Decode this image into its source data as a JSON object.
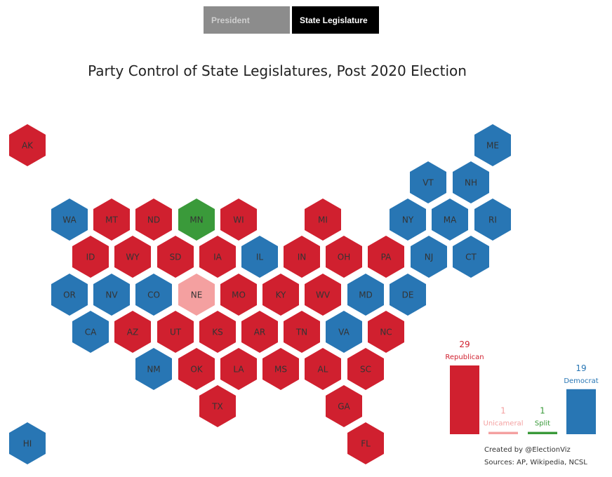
{
  "tabs": [
    {
      "label": "President",
      "active": false
    },
    {
      "label": "State Legislature",
      "active": true
    }
  ],
  "title": "Party Control of State Legislatures, Post 2020 Election",
  "colors": {
    "Republican": "#d0202f",
    "Democrat": "#2876b4",
    "Split": "#3a9a3a",
    "Unicameral": "#f4a0a0",
    "tab_inactive": "#8c8c8c",
    "tab_active": "#000000"
  },
  "chart_data": {
    "type": "heatmap",
    "title": "Party Control of State Legislatures, Post 2020 Election",
    "states": [
      {
        "abbr": "AK",
        "control": "Republican"
      },
      {
        "abbr": "ME",
        "control": "Democrat"
      },
      {
        "abbr": "VT",
        "control": "Democrat"
      },
      {
        "abbr": "NH",
        "control": "Democrat"
      },
      {
        "abbr": "WA",
        "control": "Democrat"
      },
      {
        "abbr": "MT",
        "control": "Republican"
      },
      {
        "abbr": "ND",
        "control": "Republican"
      },
      {
        "abbr": "MN",
        "control": "Split"
      },
      {
        "abbr": "WI",
        "control": "Republican"
      },
      {
        "abbr": "MI",
        "control": "Republican"
      },
      {
        "abbr": "NY",
        "control": "Democrat"
      },
      {
        "abbr": "MA",
        "control": "Democrat"
      },
      {
        "abbr": "RI",
        "control": "Democrat"
      },
      {
        "abbr": "ID",
        "control": "Republican"
      },
      {
        "abbr": "WY",
        "control": "Republican"
      },
      {
        "abbr": "SD",
        "control": "Republican"
      },
      {
        "abbr": "IA",
        "control": "Republican"
      },
      {
        "abbr": "IL",
        "control": "Democrat"
      },
      {
        "abbr": "IN",
        "control": "Republican"
      },
      {
        "abbr": "OH",
        "control": "Republican"
      },
      {
        "abbr": "PA",
        "control": "Republican"
      },
      {
        "abbr": "NJ",
        "control": "Democrat"
      },
      {
        "abbr": "CT",
        "control": "Democrat"
      },
      {
        "abbr": "OR",
        "control": "Democrat"
      },
      {
        "abbr": "NV",
        "control": "Democrat"
      },
      {
        "abbr": "CO",
        "control": "Democrat"
      },
      {
        "abbr": "NE",
        "control": "Unicameral"
      },
      {
        "abbr": "MO",
        "control": "Republican"
      },
      {
        "abbr": "KY",
        "control": "Republican"
      },
      {
        "abbr": "WV",
        "control": "Republican"
      },
      {
        "abbr": "MD",
        "control": "Democrat"
      },
      {
        "abbr": "DE",
        "control": "Democrat"
      },
      {
        "abbr": "CA",
        "control": "Democrat"
      },
      {
        "abbr": "AZ",
        "control": "Republican"
      },
      {
        "abbr": "UT",
        "control": "Republican"
      },
      {
        "abbr": "KS",
        "control": "Republican"
      },
      {
        "abbr": "AR",
        "control": "Republican"
      },
      {
        "abbr": "TN",
        "control": "Republican"
      },
      {
        "abbr": "VA",
        "control": "Democrat"
      },
      {
        "abbr": "NC",
        "control": "Republican"
      },
      {
        "abbr": "NM",
        "control": "Democrat"
      },
      {
        "abbr": "OK",
        "control": "Republican"
      },
      {
        "abbr": "LA",
        "control": "Republican"
      },
      {
        "abbr": "MS",
        "control": "Republican"
      },
      {
        "abbr": "AL",
        "control": "Republican"
      },
      {
        "abbr": "SC",
        "control": "Republican"
      },
      {
        "abbr": "TX",
        "control": "Republican"
      },
      {
        "abbr": "GA",
        "control": "Republican"
      },
      {
        "abbr": "HI",
        "control": "Democrat"
      },
      {
        "abbr": "FL",
        "control": "Republican"
      }
    ],
    "summary": {
      "type": "bar",
      "categories": [
        "Republican",
        "Unicameral",
        "Split",
        "Democrat"
      ],
      "values": [
        29,
        1,
        1,
        19
      ],
      "ylim": [
        0,
        29
      ]
    }
  },
  "credits": {
    "created_by": "Created by @ElectionViz",
    "sources": "Sources: AP, Wikipedia, NCSL"
  }
}
